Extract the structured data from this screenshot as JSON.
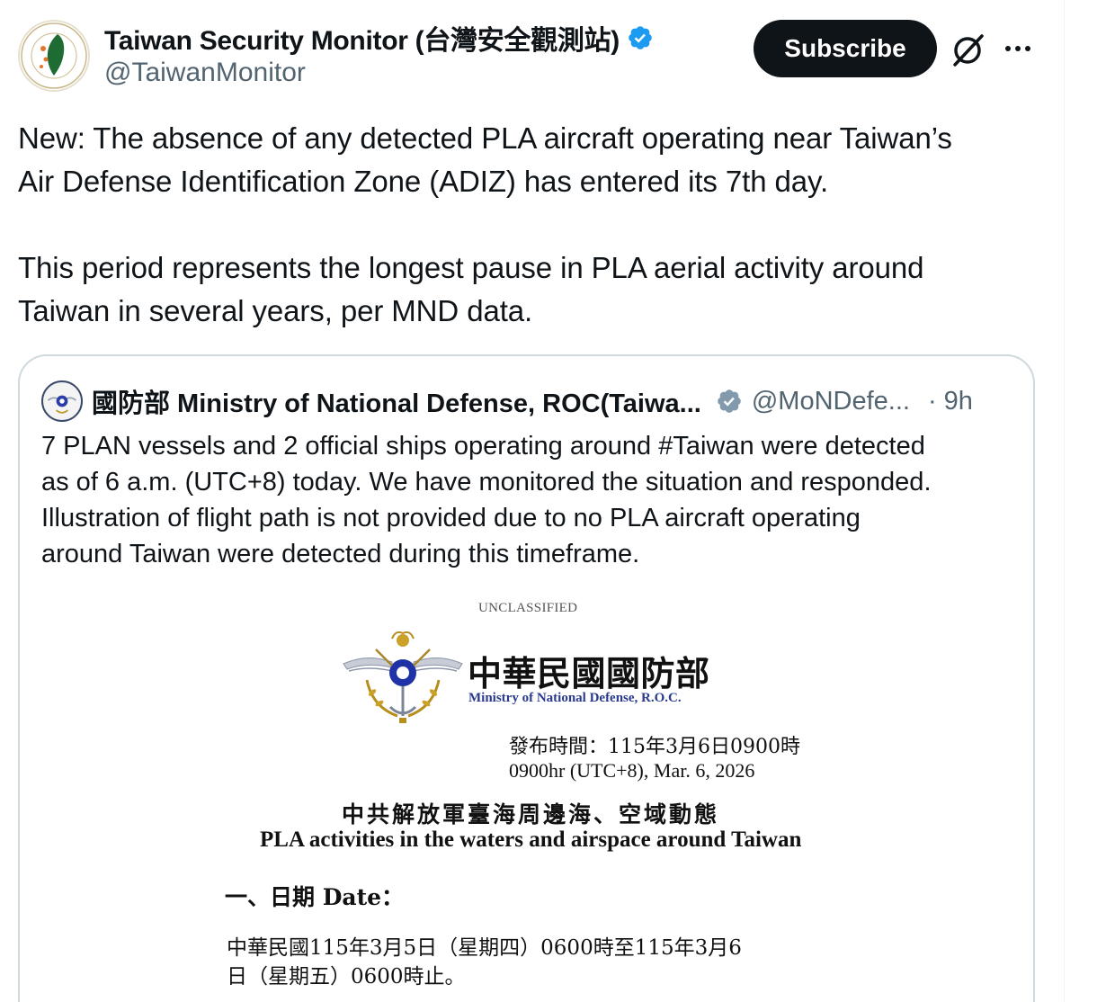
{
  "author": {
    "display_name": "Taiwan Security Monitor (台灣安全觀測站)",
    "handle": "@TaiwanMonitor",
    "avatar_ring_text": "TAIWAN SECURITY MONITOR · GEORGE MASON UNIVERSITY",
    "verified": true
  },
  "actions": {
    "subscribe_label": "Subscribe",
    "grok_icon": "grok-icon",
    "more_icon": "more-icon"
  },
  "tweet": {
    "paragraph_1_line_1": "New: The absence of any detected PLA aircraft operating near Taiwan’s",
    "paragraph_1_line_2": "Air Defense Identification Zone (ADIZ) has entered its 7th day.",
    "paragraph_2_line_1": "This period represents the longest pause in PLA aerial activity around",
    "paragraph_2_line_2": "Taiwan in several years, per MND data."
  },
  "quote": {
    "name": "國防部 Ministry of National Defense, ROC(Taiwa...",
    "handle": "@MoNDefe...",
    "time": "· 9h",
    "line_1": "7 PLAN vessels and 2 official ships operating around #Taiwan were detected",
    "line_2": "as of 6 a.m. (UTC+8) today. We have monitored the situation and responded.",
    "line_3": "Illustration of flight path is not provided due to no PLA aircraft operating",
    "line_4": "around Taiwan were detected during this timeframe."
  },
  "document": {
    "classification": "UNCLASSIFIED",
    "org_zh": "中華民國國防部",
    "org_en": "Ministry of National Defense, R.O.C.",
    "published_zh": "發布時間：115年3月6日0900時",
    "published_en": "0900hr (UTC+8), Mar. 6, 2026",
    "title_zh": "中共解放軍臺海周邊海、空域動態",
    "title_en": "PLA activities in the waters and airspace around Taiwan",
    "date_heading": "一、日期 Date：",
    "date_line_1": "中華民國115年3月5日（星期四）0600時至115年3月6",
    "date_line_2": "日（星期五）0600時止。"
  },
  "colors": {
    "text": "#0f1419",
    "secondary": "#536471",
    "verified_blue": "#1d9bf0",
    "verified_gray": "#829aab",
    "border": "#cfd9de",
    "doc_blue": "#2a3b8f"
  }
}
